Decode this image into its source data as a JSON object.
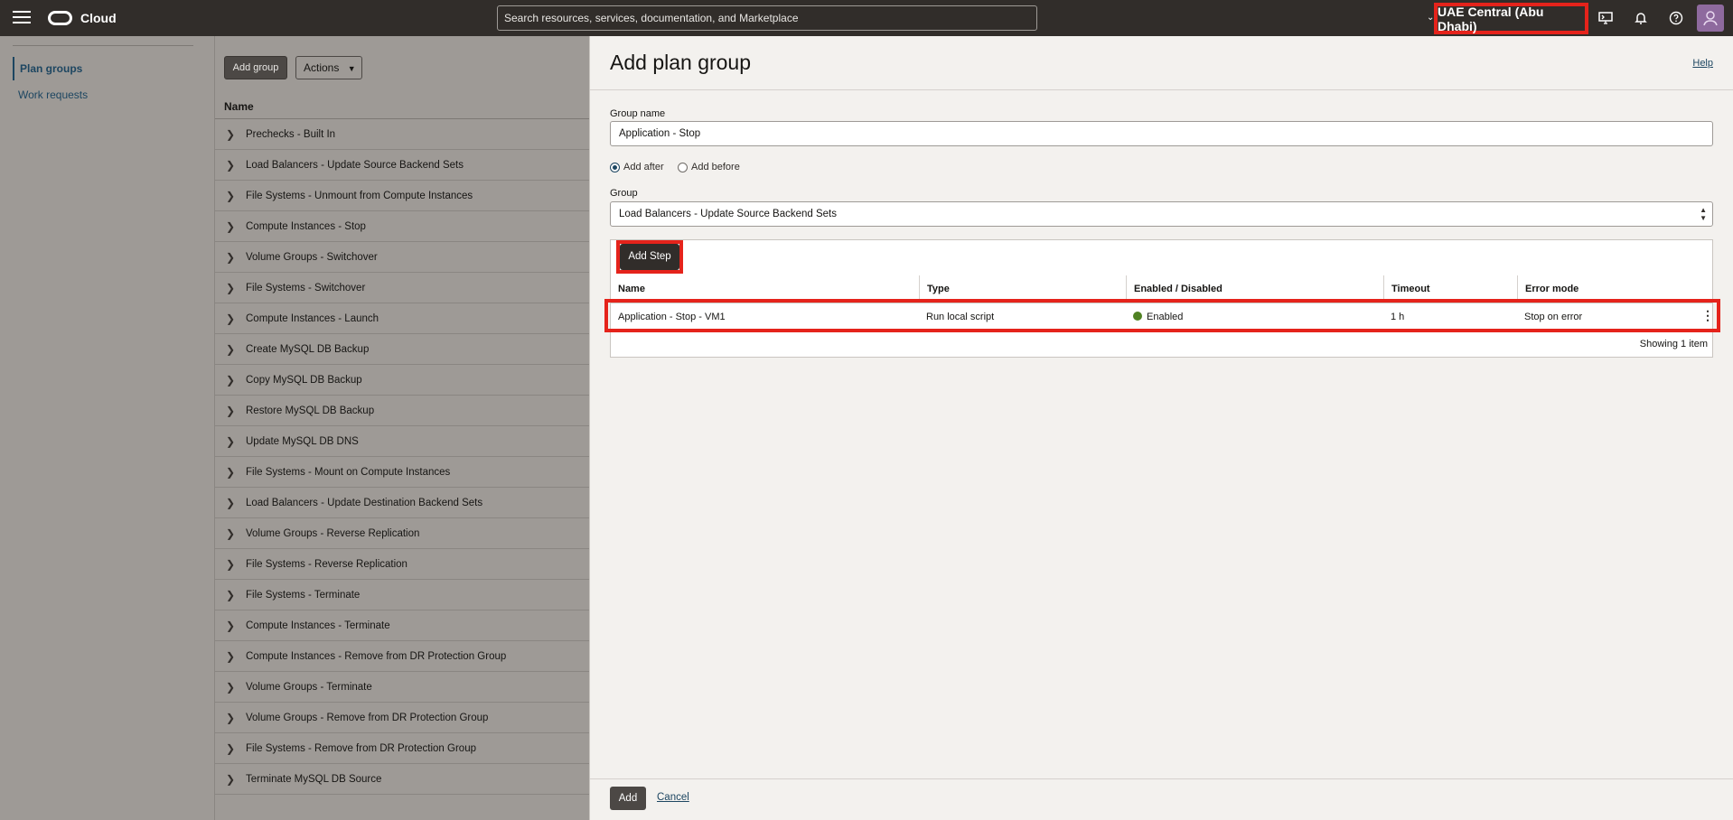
{
  "topbar": {
    "brand": "Cloud",
    "search_placeholder": "Search resources, services, documentation, and Marketplace",
    "region": "UAE Central (Abu Dhabi)",
    "icons": [
      "menu-icon",
      "oracle-logo",
      "cloud-shell-icon",
      "bell-icon",
      "help-icon",
      "profile-avatar"
    ]
  },
  "leftnav": {
    "items": [
      "Plan groups",
      "Work requests"
    ],
    "active": "Plan groups"
  },
  "list": {
    "add_group": "Add group",
    "actions": "Actions",
    "column": "Name",
    "groups": [
      "Prechecks - Built In",
      "Load Balancers - Update Source Backend Sets",
      "File Systems - Unmount from Compute Instances",
      "Compute Instances - Stop",
      "Volume Groups - Switchover",
      "File Systems - Switchover",
      "Compute Instances - Launch",
      "Create MySQL DB Backup",
      "Copy MySQL DB Backup",
      "Restore MySQL DB Backup",
      "Update MySQL DB DNS",
      "File Systems - Mount on Compute Instances",
      "Load Balancers - Update Destination Backend Sets",
      "Volume Groups - Reverse Replication",
      "File Systems - Reverse Replication",
      "File Systems - Terminate",
      "Compute Instances - Terminate",
      "Compute Instances - Remove from DR Protection Group",
      "Volume Groups - Terminate",
      "Volume Groups - Remove from DR Protection Group",
      "File Systems - Remove from DR Protection Group",
      "Terminate MySQL DB Source"
    ]
  },
  "panel": {
    "title": "Add plan group",
    "help": "Help",
    "group_name_label": "Group name",
    "group_name_value": "Application - Stop",
    "radio_after": "Add after",
    "radio_before": "Add before",
    "radio_selected": "Add after",
    "group_label": "Group",
    "group_value": "Load Balancers - Update Source Backend Sets",
    "add_step": "Add Step",
    "columns": [
      "Name",
      "Type",
      "Enabled / Disabled",
      "Timeout",
      "Error mode"
    ],
    "rows": [
      {
        "name": "Application - Stop - VM1",
        "type": "Run local script",
        "enabled": "Enabled",
        "timeout": "1 h",
        "error_mode": "Stop on error"
      }
    ],
    "status_color": "#508223",
    "showing": "Showing 1 item",
    "add_button": "Add",
    "cancel": "Cancel"
  }
}
